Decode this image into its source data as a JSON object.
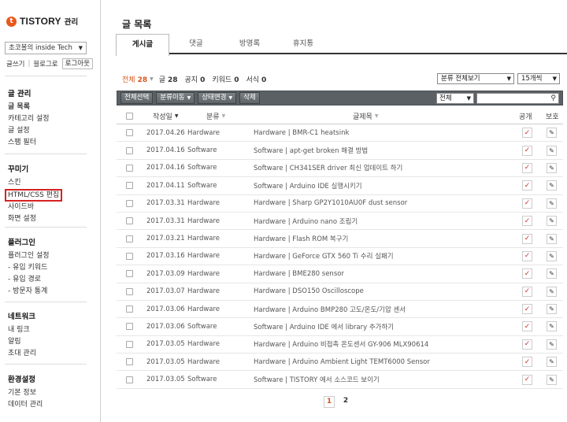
{
  "brand": {
    "mark": "t",
    "name": "TISTORY",
    "sub": "관리"
  },
  "blog_select": {
    "value": "초코볼의 inside Tech"
  },
  "toplinks": {
    "write": "글쓰기",
    "blog": "블로그로",
    "logout": "로그아웃"
  },
  "sidebar": {
    "groups": [
      {
        "head": "글 관리",
        "items": [
          "글 목록",
          "카테고리 설정",
          "글 설정",
          "스팸 필터"
        ]
      },
      {
        "head": "꾸미기",
        "items": [
          "스킨",
          "HTML/CSS 편집",
          "사이드바",
          "화면 설정"
        ]
      },
      {
        "head": "플러그인",
        "items": [
          "플러그인 설정",
          "- 유입 키워드",
          "- 유입 경로",
          "- 방문자 통계"
        ]
      },
      {
        "head": "네트워크",
        "items": [
          "내 링크",
          "알림",
          "초대 관리"
        ]
      },
      {
        "head": "환경설정",
        "items": [
          "기본 정보",
          "데이터 관리"
        ]
      }
    ]
  },
  "page_title": "글 목록",
  "tabs": [
    "게시글",
    "댓글",
    "방명록",
    "휴지통"
  ],
  "stats": [
    {
      "label": "전체",
      "count": "28"
    },
    {
      "label": "글",
      "count": "28"
    },
    {
      "label": "공지",
      "count": "0"
    },
    {
      "label": "키워드",
      "count": "0"
    },
    {
      "label": "서식",
      "count": "0"
    }
  ],
  "category_filter": {
    "value": "분류 전체보기"
  },
  "per_page": {
    "value": "15개씩"
  },
  "toolbar": {
    "select_all": "전체선택",
    "move": "분류이동",
    "status": "상태변경",
    "delete": "삭제",
    "search_scope": "전체",
    "search_value": ""
  },
  "table": {
    "headers": {
      "date": "작성일",
      "category": "분류",
      "title": "글제목",
      "public": "공개",
      "protect": "보호"
    },
    "rows": [
      {
        "date": "2017.04.26",
        "category": "Hardware",
        "title": "Hardware | BMR-C1 heatsink"
      },
      {
        "date": "2017.04.16",
        "category": "Software",
        "title": "Software | apt-get broken 해결 방법"
      },
      {
        "date": "2017.04.16",
        "category": "Software",
        "title": "Software | CH341SER driver 최신 업데이트 하기"
      },
      {
        "date": "2017.04.11",
        "category": "Software",
        "title": "Software | Arduino IDE 실행시키기"
      },
      {
        "date": "2017.03.31",
        "category": "Hardware",
        "title": "Hardware | Sharp GP2Y1010AU0F dust sensor"
      },
      {
        "date": "2017.03.31",
        "category": "Hardware",
        "title": "Hardware | Arduino nano 조립기"
      },
      {
        "date": "2017.03.21",
        "category": "Hardware",
        "title": "Hardware | Flash ROM 복구기"
      },
      {
        "date": "2017.03.16",
        "category": "Hardware",
        "title": "Hardware | GeForce GTX 560 Ti 수리 실패기"
      },
      {
        "date": "2017.03.09",
        "category": "Hardware",
        "title": "Hardware | BME280 sensor"
      },
      {
        "date": "2017.03.07",
        "category": "Hardware",
        "title": "Hardware | DSO150 Oscilloscope"
      },
      {
        "date": "2017.03.06",
        "category": "Hardware",
        "title": "Hardware | Arduino BMP280 고도/온도/기압 센서"
      },
      {
        "date": "2017.03.06",
        "category": "Software",
        "title": "Software | Arduino IDE 에서 library 추가하기"
      },
      {
        "date": "2017.03.05",
        "category": "Hardware",
        "title": "Hardware | Arduino 비접촉 온도센서 GY-906 MLX90614"
      },
      {
        "date": "2017.03.05",
        "category": "Hardware",
        "title": "Hardware | Arduino Ambient Light TEMT6000 Sensor"
      },
      {
        "date": "2017.03.05",
        "category": "Software",
        "title": "Software | TISTORY 에서 소스코드 보이기"
      }
    ]
  },
  "pagination": [
    "1",
    "2"
  ],
  "colors": {
    "accent": "#d9541c",
    "toolbar": "#5a6064",
    "highlight_box": "#d62222",
    "check": "#c6342a"
  }
}
